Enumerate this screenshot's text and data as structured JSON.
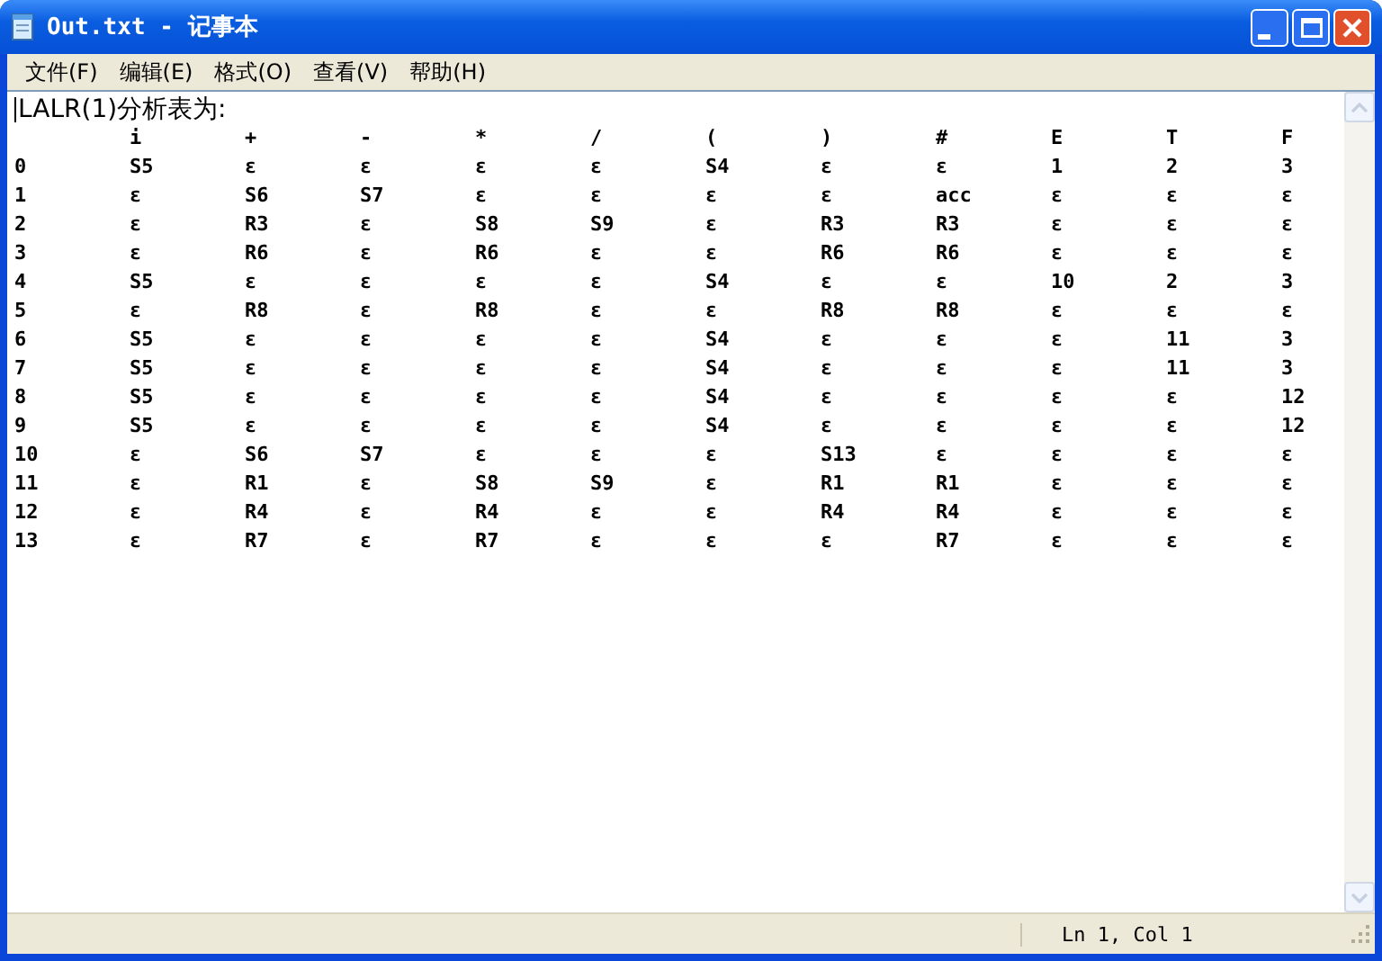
{
  "window": {
    "title": "Out.txt - 记事本"
  },
  "menu": [
    {
      "label": "文件(F)"
    },
    {
      "label": "编辑(E)"
    },
    {
      "label": "格式(O)"
    },
    {
      "label": "查看(V)"
    },
    {
      "label": "帮助(H)"
    }
  ],
  "document": {
    "heading": "LALR(1)分析表为:",
    "columns": [
      "i",
      "+",
      "-",
      "*",
      "/",
      "(",
      ")",
      "#",
      "E",
      "T",
      "F"
    ],
    "rows": [
      {
        "state": "0",
        "cells": [
          "S5",
          "ε",
          "ε",
          "ε",
          "ε",
          "S4",
          "ε",
          "ε",
          "1",
          "2",
          "3"
        ]
      },
      {
        "state": "1",
        "cells": [
          "ε",
          "S6",
          "S7",
          "ε",
          "ε",
          "ε",
          "ε",
          "acc",
          "ε",
          "ε",
          "ε"
        ]
      },
      {
        "state": "2",
        "cells": [
          "ε",
          "R3",
          "ε",
          "S8",
          "S9",
          "ε",
          "R3",
          "R3",
          "ε",
          "ε",
          "ε"
        ]
      },
      {
        "state": "3",
        "cells": [
          "ε",
          "R6",
          "ε",
          "R6",
          "ε",
          "ε",
          "R6",
          "R6",
          "ε",
          "ε",
          "ε"
        ]
      },
      {
        "state": "4",
        "cells": [
          "S5",
          "ε",
          "ε",
          "ε",
          "ε",
          "S4",
          "ε",
          "ε",
          "10",
          "2",
          "3"
        ]
      },
      {
        "state": "5",
        "cells": [
          "ε",
          "R8",
          "ε",
          "R8",
          "ε",
          "ε",
          "R8",
          "R8",
          "ε",
          "ε",
          "ε"
        ]
      },
      {
        "state": "6",
        "cells": [
          "S5",
          "ε",
          "ε",
          "ε",
          "ε",
          "S4",
          "ε",
          "ε",
          "ε",
          "11",
          "3"
        ]
      },
      {
        "state": "7",
        "cells": [
          "S5",
          "ε",
          "ε",
          "ε",
          "ε",
          "S4",
          "ε",
          "ε",
          "ε",
          "11",
          "3"
        ]
      },
      {
        "state": "8",
        "cells": [
          "S5",
          "ε",
          "ε",
          "ε",
          "ε",
          "S4",
          "ε",
          "ε",
          "ε",
          "ε",
          "12"
        ]
      },
      {
        "state": "9",
        "cells": [
          "S5",
          "ε",
          "ε",
          "ε",
          "ε",
          "S4",
          "ε",
          "ε",
          "ε",
          "ε",
          "12"
        ]
      },
      {
        "state": "10",
        "cells": [
          "ε",
          "S6",
          "S7",
          "ε",
          "ε",
          "ε",
          "S13",
          "ε",
          "ε",
          "ε",
          "ε"
        ]
      },
      {
        "state": "11",
        "cells": [
          "ε",
          "R1",
          "ε",
          "S8",
          "S9",
          "ε",
          "R1",
          "R1",
          "ε",
          "ε",
          "ε"
        ]
      },
      {
        "state": "12",
        "cells": [
          "ε",
          "R4",
          "ε",
          "R4",
          "ε",
          "ε",
          "R4",
          "R4",
          "ε",
          "ε",
          "ε"
        ]
      },
      {
        "state": "13",
        "cells": [
          "ε",
          "R7",
          "ε",
          "R7",
          "ε",
          "ε",
          "ε",
          "R7",
          "ε",
          "ε",
          "ε"
        ]
      }
    ]
  },
  "status_bar": {
    "position": "Ln 1, Col 1"
  }
}
